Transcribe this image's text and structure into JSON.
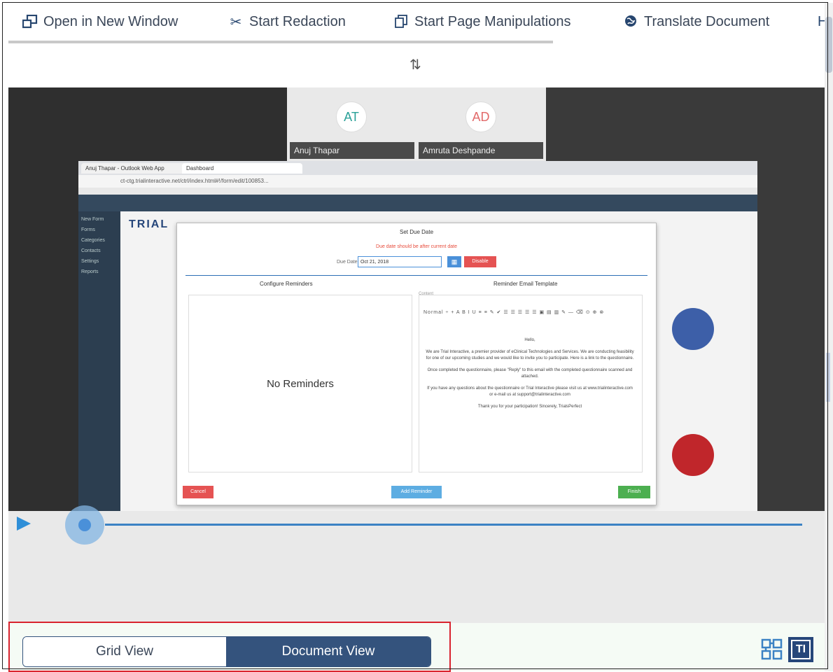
{
  "toolbar": {
    "open_new_window": "Open in New Window",
    "start_redaction": "Start Redaction",
    "start_page_manipulations": "Start Page Manipulations",
    "translate_document": "Translate Document"
  },
  "participants": [
    {
      "initials": "AT",
      "name": "Anuj Thapar"
    },
    {
      "initials": "AD",
      "name": "Amruta Deshpande"
    }
  ],
  "browser": {
    "tab1": "Anuj Thapar - Outlook Web App",
    "tab2": "Dashboard",
    "address": "ct-ctg.trialinteractive.net/ctrl/index.html#!/form/edit/100853..."
  },
  "app": {
    "logo_text": "TRIAL",
    "sidenav": [
      "New Form",
      "Forms",
      "Categories",
      "Contacts",
      "Settings",
      "Reports"
    ]
  },
  "modal": {
    "title": "Set Due Date",
    "error": "Due date should be after current date",
    "due_label": "Due Date",
    "due_value": "Oct 21, 2018",
    "disable": "Disable",
    "configure_reminders": "Configure Reminders",
    "email_template": "Reminder Email Template",
    "content_label": "Content",
    "no_reminders": "No Reminders",
    "editor_toolbar": "Normal ÷ + A B I U ≡ ≡ ✎ ✔ ☰ ☰ ☰ ☰ ☰ ▣ ▤ ▥ ✎ — ⌫ ⊙ ⊕ ⊗",
    "email_greeting": "Hello,",
    "email_p1": "We are Trial Interactive, a premier provider of eClinical Technologies and Services. We are conducting feasibility for one of our upcoming studies and we would like to invite you to participate. Here is a link to the questionnaire.",
    "email_p2": "Once completed the questionnaire, please \"Reply\" to this email with the completed questionnaire scanned and attached.",
    "email_p3": "If you have any questions about the questionnaire or Trial Interactive please visit us at www.trialinteractive.com or e-mail us at support@trialinteractive.com",
    "email_p4": "Thank you for your participation! Sincerely, TrialsPerfect",
    "cancel": "Cancel",
    "add_reminder": "Add Reminder",
    "finish": "Finish"
  },
  "player": {
    "progress_fraction": 0.0
  },
  "view_toggle": {
    "grid": "Grid View",
    "document": "Document View",
    "selected": "Document View"
  },
  "logo": {
    "text": "TI"
  }
}
